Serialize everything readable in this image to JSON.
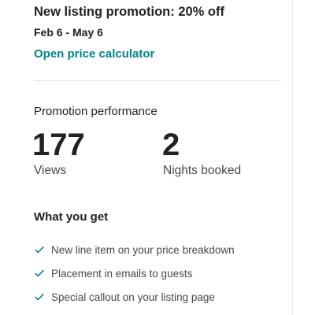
{
  "promotion": {
    "title": "New listing promotion: 20% off",
    "dates": "Feb 6 - May 6",
    "calculator_link": "Open price calculator"
  },
  "performance": {
    "title": "Promotion performance",
    "metrics": [
      {
        "value": "177",
        "label": "Views"
      },
      {
        "value": "2",
        "label": "Nights booked"
      }
    ]
  },
  "benefits": {
    "title": "What you get",
    "icon": "check-icon",
    "check_color": "#008489",
    "items": [
      "New line item on your price breakdown",
      "Placement in emails to guests",
      "Special callout on your listing page"
    ]
  }
}
